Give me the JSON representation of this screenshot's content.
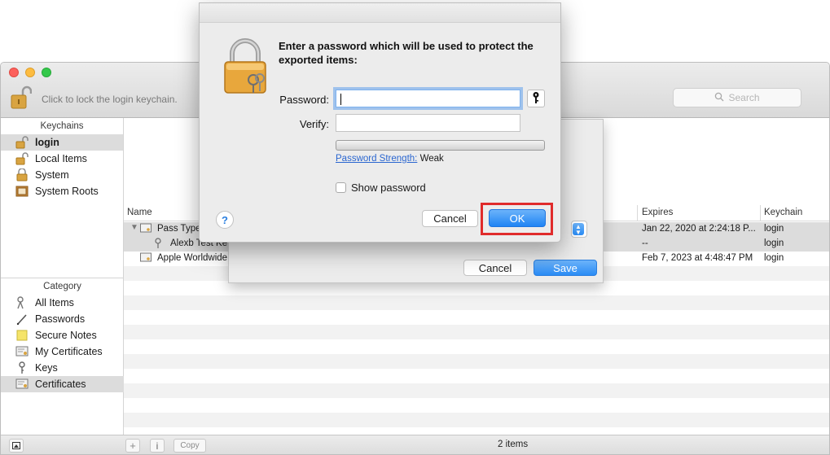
{
  "window": {
    "lock_hint": "Click to lock the login keychain.",
    "search_placeholder": "Search"
  },
  "sidebar": {
    "keychains_header": "Keychains",
    "keychains": [
      {
        "label": "login",
        "icon": "unlocked-padlock-icon",
        "selected": true
      },
      {
        "label": "Local Items",
        "icon": "unlocked-padlock-icon"
      },
      {
        "label": "System",
        "icon": "padlock-icon"
      },
      {
        "label": "System Roots",
        "icon": "cabinet-icon"
      }
    ],
    "category_header": "Category",
    "categories": [
      {
        "label": "All Items",
        "icon": "keys-icon"
      },
      {
        "label": "Passwords",
        "icon": "pencil-icon"
      },
      {
        "label": "Secure Notes",
        "icon": "note-icon"
      },
      {
        "label": "My Certificates",
        "icon": "certificate-icon"
      },
      {
        "label": "Keys",
        "icon": "key-icon"
      },
      {
        "label": "Certificates",
        "icon": "certificate-icon",
        "selected": true
      }
    ]
  },
  "table": {
    "columns": {
      "name": "Name",
      "expires": "Expires",
      "keychain": "Keychain"
    },
    "rows": [
      {
        "name": "Pass Type",
        "expires": "Jan 22, 2020 at 2:24:18 P...",
        "keychain": "login"
      },
      {
        "name": "Alexb Test Ke",
        "expires": "--",
        "keychain": "login"
      },
      {
        "name": "Apple Worldwide",
        "expires": "Feb 7, 2023 at 4:48:47 PM",
        "keychain": "login"
      }
    ]
  },
  "bottom_bar": {
    "add_label": "+",
    "info_label": "i",
    "copy_label": "Copy",
    "items_count": "2 items"
  },
  "save_sheet": {
    "cancel_label": "Cancel",
    "save_label": "Save"
  },
  "password_dialog": {
    "message": "Enter a password which will be used to protect the exported items:",
    "password_label": "Password:",
    "password_value": "",
    "verify_label": "Verify:",
    "verify_value": "",
    "strength_link": "Password Strength:",
    "strength_value": "Weak",
    "strength_level": 0,
    "show_password_label": "Show password",
    "show_password_checked": false,
    "help_label": "?",
    "cancel_label": "Cancel",
    "ok_label": "OK"
  },
  "colors": {
    "accent": "#2a8cf5",
    "highlight_box": "#e02b2b"
  }
}
